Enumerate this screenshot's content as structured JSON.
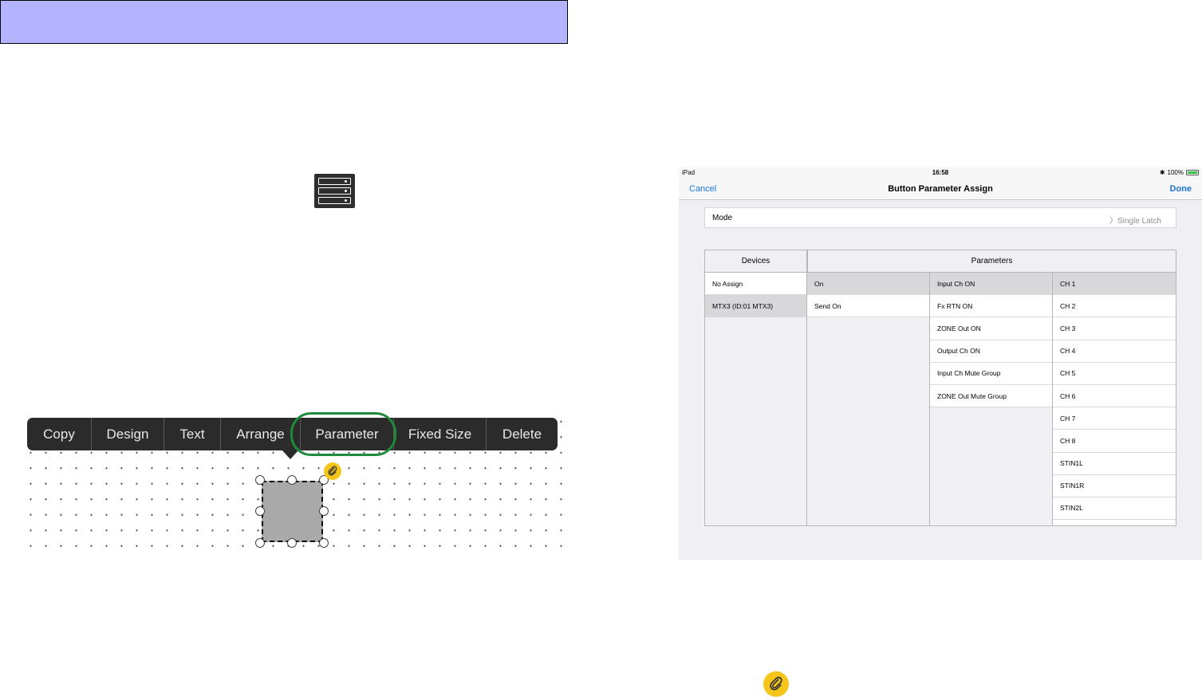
{
  "edit_menu": {
    "items": [
      "Copy",
      "Design",
      "Text",
      "Arrange",
      "Parameter",
      "Fixed Size",
      "Delete"
    ],
    "highlighted": "Parameter",
    "highlight_color": "#1f8b3a"
  },
  "colors": {
    "header_bar": "#b3b3ff",
    "menu_bg": "#2b2b2b",
    "link_badge": "#f6c51a",
    "ios_blue": "#1a73d9"
  },
  "icons": {
    "rack": "device-rack-icon",
    "link": "paperclip-link-icon"
  },
  "ipad": {
    "status": {
      "carrier": "iPad",
      "time": "16:58",
      "battery": "100%"
    },
    "nav": {
      "cancel": "Cancel",
      "title": "Button Parameter Assign",
      "done": "Done"
    },
    "mode": {
      "label": "Mode",
      "value": "Single Latch"
    },
    "devices": {
      "header": "Devices",
      "items": [
        "No Assign",
        "MTX3 (ID:01 MTX3)"
      ],
      "selected": "MTX3 (ID:01 MTX3)"
    },
    "parameters_header": "Parameters",
    "param_col1": {
      "items": [
        "On",
        "Send On"
      ],
      "selected": "On"
    },
    "param_col2": {
      "items": [
        "Input Ch ON",
        "Fx RTN ON",
        "ZONE Out ON",
        "Output Ch ON",
        "Input Ch Mute Group",
        "ZONE Out Mute Group"
      ],
      "selected": "Input Ch ON"
    },
    "param_col3": {
      "items": [
        "CH 1",
        "CH 2",
        "CH 3",
        "CH 4",
        "CH 5",
        "CH 6",
        "CH 7",
        "CH 8",
        "STIN1L",
        "STIN1R",
        "STIN2L"
      ],
      "selected": "CH 1"
    }
  }
}
